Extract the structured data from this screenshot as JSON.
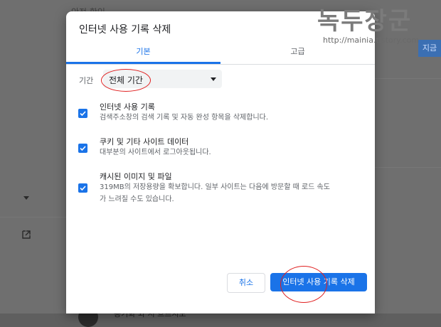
{
  "background": {
    "top_text": "안전 확인",
    "bottom_text": "동기화 와 서 흐르지도",
    "right_button": "지금"
  },
  "watermark": {
    "title": "녹두장군",
    "url": "http://mainia.tistory.com"
  },
  "dialog": {
    "title": "인터넷 사용 기록 삭제",
    "tabs": [
      {
        "label": "기본",
        "active": true
      },
      {
        "label": "고급",
        "active": false
      }
    ],
    "time_range": {
      "label": "기간",
      "value": "전체 기간"
    },
    "options": [
      {
        "title": "인터넷 사용 기록",
        "description": "검색주소창의 검색 기록 및 자동 완성 항목을 삭제합니다.",
        "checked": true
      },
      {
        "title": "쿠키 및 기타 사이트 데이터",
        "description": "대부분의 사이트에서 로그아웃됩니다.",
        "checked": true
      },
      {
        "title": "캐시된 이미지 및 파일",
        "description": "319MB의 저장용량을 확보합니다. 일부 사이트는 다음에 방문할 때 로드 속도가 느려질 수도 있습니다.",
        "checked": true
      }
    ],
    "cancel_label": "취소",
    "clear_label": "인터넷 사용 기록 삭제"
  },
  "colors": {
    "accent": "#1a73e8",
    "annotation": "#e02020",
    "overlay": "#6f6f6f"
  }
}
